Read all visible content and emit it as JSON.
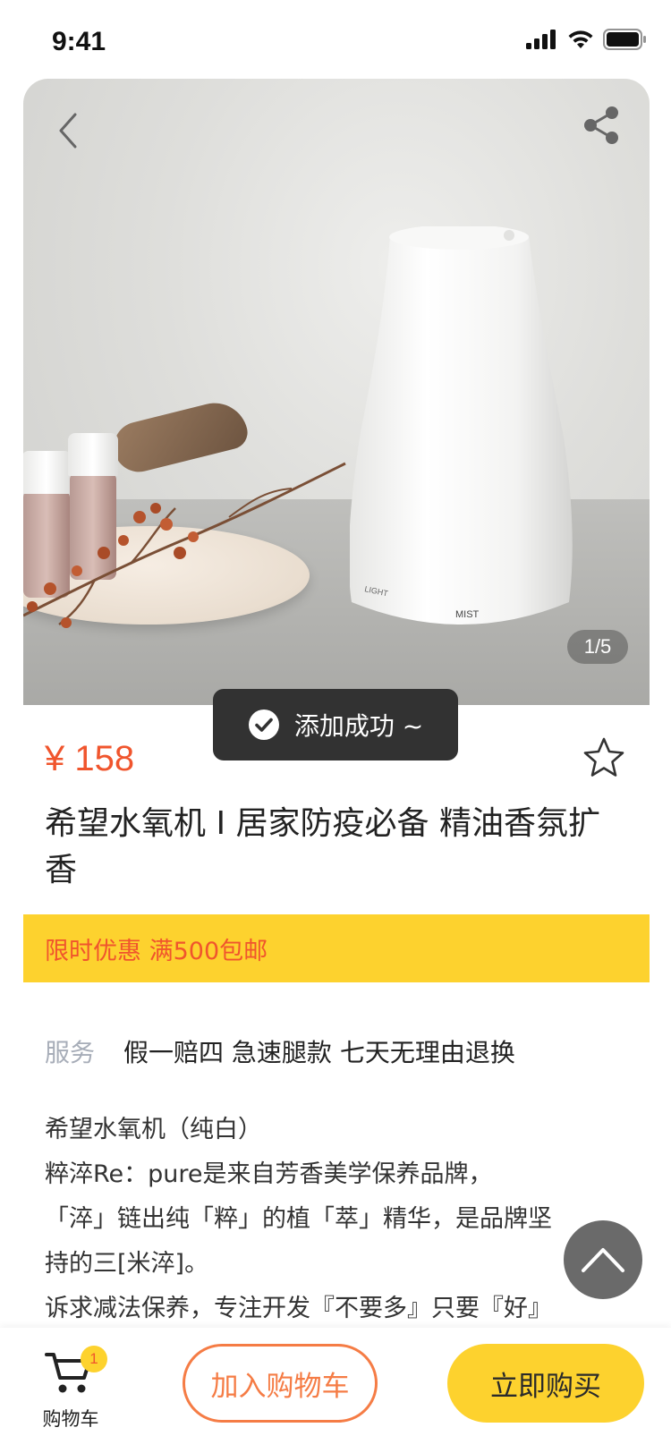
{
  "status_bar": {
    "time": "9:41"
  },
  "product": {
    "image_index": "1/5",
    "price": "¥ 158",
    "title": "希望水氧机 I 居家防疫必备 精油香氛扩香",
    "promo": "限时优惠 满500包邮",
    "service_label": "服务",
    "service_text": "假一赔四 急速腿款 七天无理由退换",
    "description_lines": [
      "希望水氧机（纯白）",
      "粹淬Re：pure是来自芳香美学保养品牌，",
      "「淬」链出纯「粹」的植「萃」精华，是品牌坚",
      "持的三[米淬]。",
      "诉求减法保养，专注开发『不要多』只要『好』"
    ]
  },
  "toast": {
    "text": "添加成功 ~"
  },
  "bottom_bar": {
    "cart_label": "购物车",
    "cart_badge": "1",
    "add_to_cart": "加入购物车",
    "buy_now": "立即购买"
  },
  "colors": {
    "accent_red": "#f0552d",
    "accent_yellow": "#fdd22e",
    "accent_orange": "#f57c45"
  }
}
